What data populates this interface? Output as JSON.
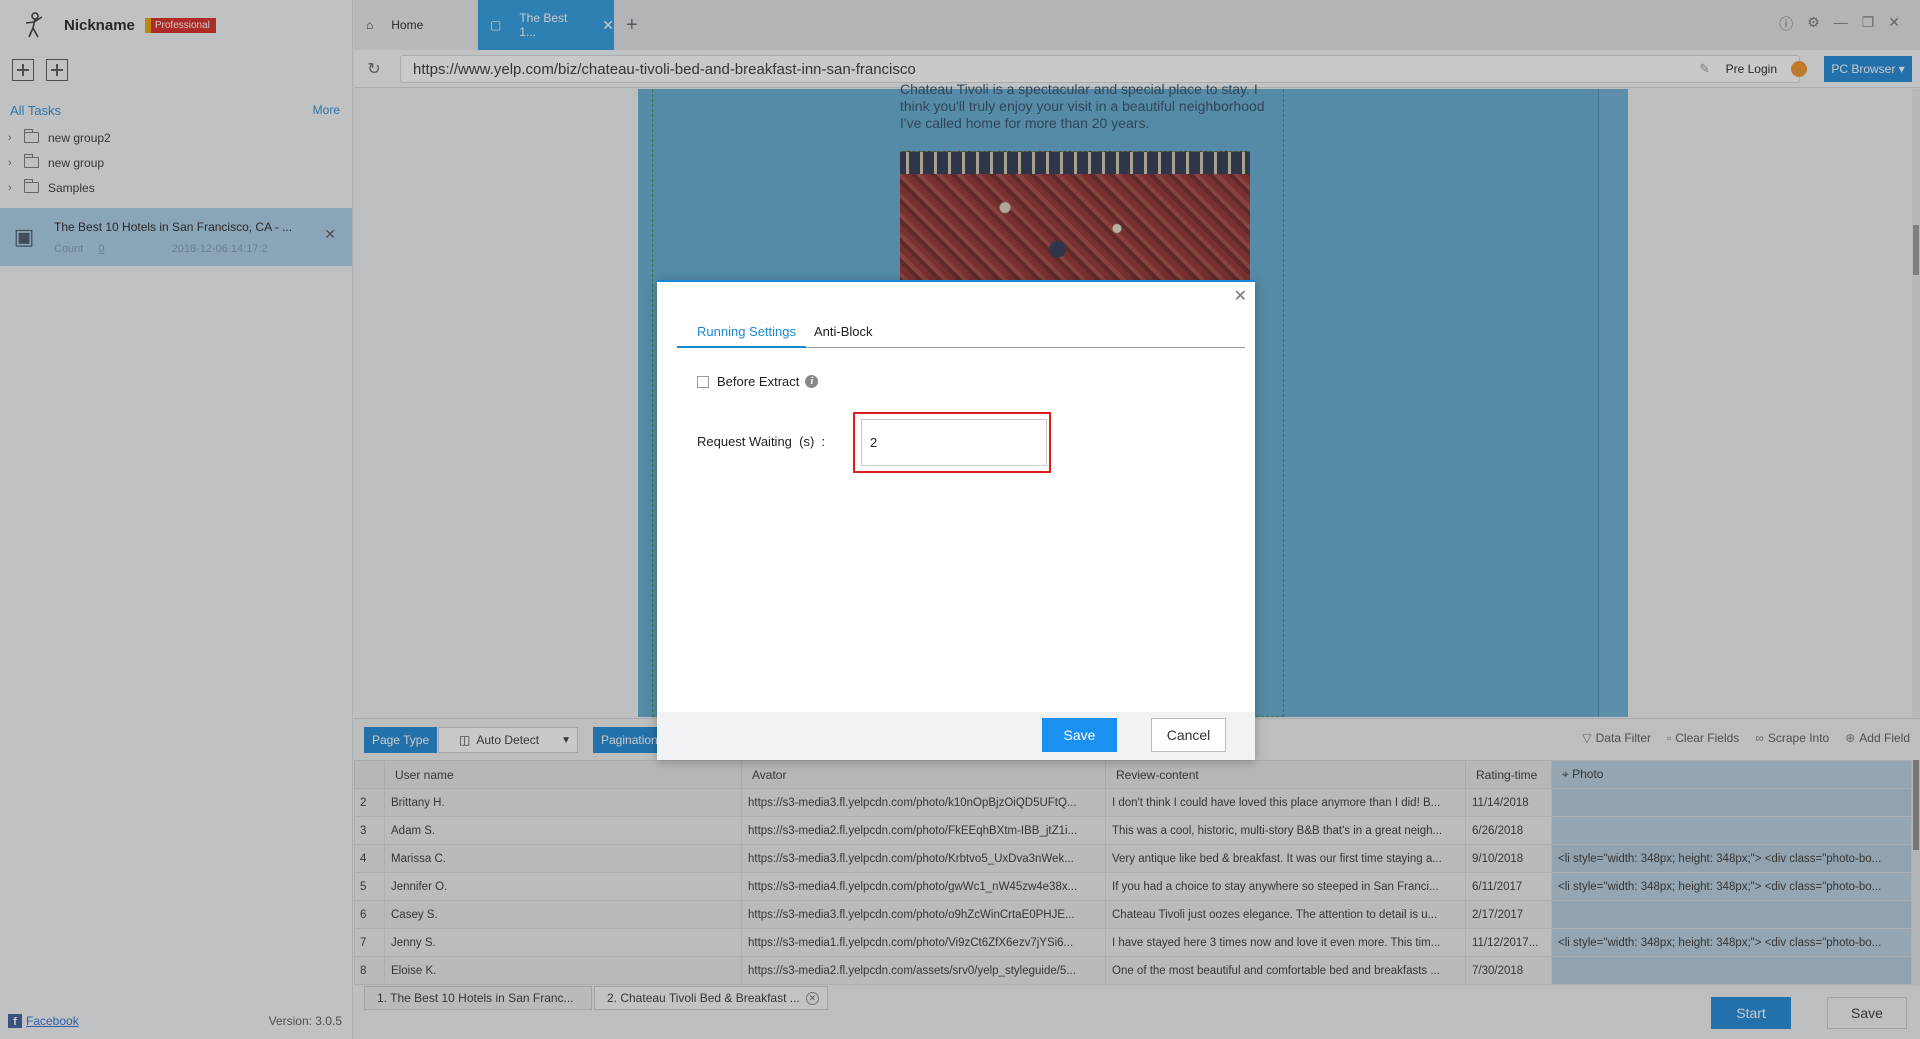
{
  "sidebar": {
    "brand": {
      "nickname": "Nickname",
      "badge": "Professional",
      "logo_icon": "person-logo-icon"
    },
    "tools": [
      "new-task-icon",
      "new-group-icon"
    ],
    "tasks_header": {
      "all_tasks": "All Tasks",
      "more": "More"
    },
    "groups": [
      {
        "label": "new group2"
      },
      {
        "label": "new group"
      },
      {
        "label": "Samples"
      }
    ],
    "task": {
      "title": "The Best 10 Hotels in San Francisco, CA - ...",
      "count_label": "Count",
      "count": "0",
      "date": "2018-12-06 14:17:2"
    },
    "footer": {
      "facebook": "Facebook",
      "version": "Version: 3.0.5"
    }
  },
  "tabs": [
    {
      "label": "Home",
      "icon": "home-icon"
    },
    {
      "label": "The Best 1...",
      "icon": "page-icon"
    }
  ],
  "urlbar": {
    "url": "https://www.yelp.com/biz/chateau-tivoli-bed-and-breakfast-inn-san-francisco",
    "pre_login": "Pre Login",
    "pc_browser": "PC Browser"
  },
  "webpage": {
    "paragraph": "Chateau Tivoli is a spectacular and special place to stay. I think you'll truly enjoy your visit in a beautiful neighborhood I've called home for more than 20 years."
  },
  "panel": {
    "page_type": "Page Type",
    "auto_detect": "Auto Detect",
    "pagination": "Pagination",
    "actions": [
      {
        "label": "Data Filter",
        "icon": "filter-icon"
      },
      {
        "label": "Clear Fields",
        "icon": "trash-icon"
      },
      {
        "label": "Scrape Into",
        "icon": "link-icon"
      },
      {
        "label": "Add Field",
        "icon": "plus-circle-icon"
      }
    ]
  },
  "grid": {
    "columns": [
      "",
      "User name",
      "Avator",
      "Review-content",
      "Rating-time",
      "Photo"
    ],
    "rows": [
      [
        "2",
        "Brittany H.",
        "https://s3-media3.fl.yelpcdn.com/photo/k10nOpBjzOiQD5UFtQ...",
        "I don't think I could have loved this place anymore than I did! B...",
        "11/14/2018",
        ""
      ],
      [
        "3",
        "Adam S.",
        "https://s3-media2.fl.yelpcdn.com/photo/FkEEqhBXtm-IBB_jtZ1i...",
        "This was a cool, historic, multi-story B&B that's in a great neigh...",
        "6/26/2018",
        ""
      ],
      [
        "4",
        "Marissa C.",
        "https://s3-media3.fl.yelpcdn.com/photo/Krbtvo5_UxDva3nWek...",
        "Very antique like bed & breakfast. It was our first time staying a...",
        "9/10/2018",
        "<li style=\"width: 348px; height: 348px;\"> <div class=\"photo-bo..."
      ],
      [
        "5",
        "Jennifer O.",
        "https://s3-media4.fl.yelpcdn.com/photo/gwWc1_nW45zw4e38x...",
        "If you had a choice to stay anywhere so steeped in San Franci...",
        "6/11/2017",
        "<li style=\"width: 348px; height: 348px;\"> <div class=\"photo-bo..."
      ],
      [
        "6",
        "Casey S.",
        "https://s3-media3.fl.yelpcdn.com/photo/o9hZcWinCrtaE0PHJE...",
        "Chateau Tivoli just oozes elegance. The attention to detail is u...",
        "2/17/2017",
        ""
      ],
      [
        "7",
        "Jenny S.",
        "https://s3-media1.fl.yelpcdn.com/photo/Vi9zCt6ZfX6ezv7jYSi6...",
        "I have stayed here 3 times now and love it even more. This tim...",
        "11/12/2017...",
        "<li style=\"width: 348px; height: 348px;\"> <div class=\"photo-bo..."
      ],
      [
        "8",
        "Eloise K.",
        "https://s3-media2.fl.yelpcdn.com/assets/srv0/yelp_styleguide/5...",
        "One of the most beautiful and comfortable bed and breakfasts ...",
        "7/30/2018",
        ""
      ]
    ]
  },
  "subtabs": [
    {
      "label": "1.  The Best 10 Hotels in San Franc..."
    },
    {
      "label": "2.  Chateau Tivoli Bed & Breakfast ..."
    }
  ],
  "footer": {
    "start": "Start",
    "save": "Save"
  },
  "dialog": {
    "tabs": [
      "Running Settings",
      "Anti-Block"
    ],
    "before_extract": "Before Extract",
    "request_waiting_label": "Request Waiting  (s)  :",
    "request_waiting_value": "2",
    "save": "Save",
    "cancel": "Cancel"
  },
  "colors": {
    "accent": "#1a86d6",
    "highlight": "#e01b1b",
    "badge": "#d9261c"
  }
}
